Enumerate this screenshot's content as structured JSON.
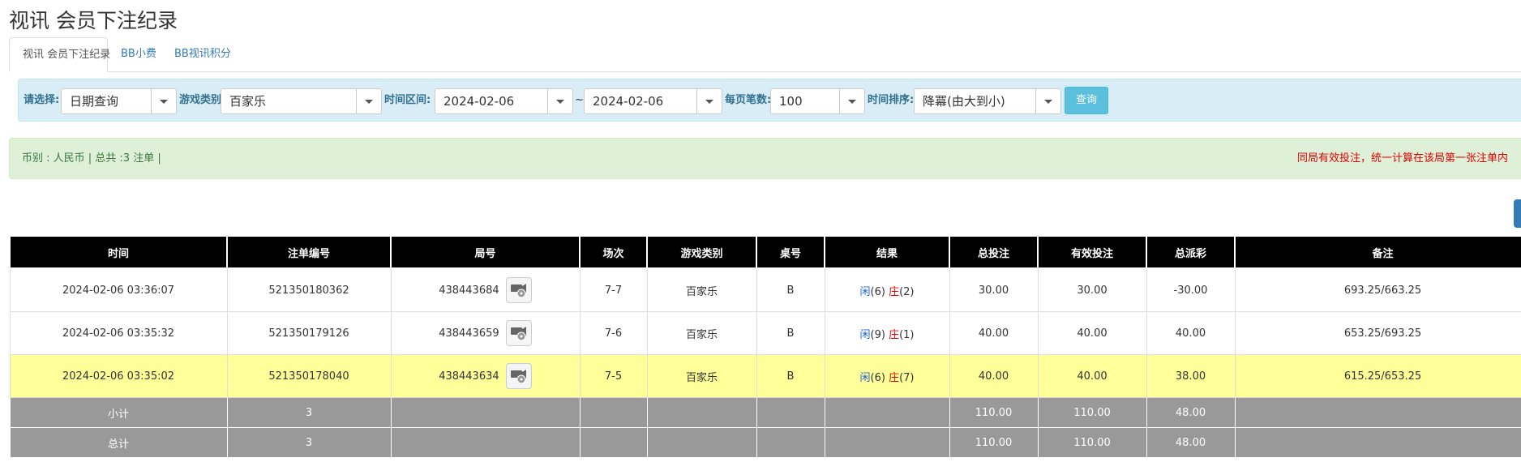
{
  "page": {
    "title": "视讯 会员下注纪录"
  },
  "tabs": [
    {
      "label": "视讯 会员下注纪录",
      "active": true
    },
    {
      "label": "BB小费",
      "active": false
    },
    {
      "label": "BB视讯积分",
      "active": false
    }
  ],
  "filters": {
    "select_label": "请选择:",
    "select_value": "日期查询",
    "game_type_label": "游戏类别",
    "game_type_value": "百家乐",
    "time_range_label": "时间区间:",
    "date_from": "2024-02-06",
    "range_separator": "~",
    "date_to": "2024-02-06",
    "per_page_label": "每页笔数:",
    "per_page_value": "100",
    "sort_label": "时间排序:",
    "sort_value": "降冪(由大到小)",
    "query_button": "查询"
  },
  "summary": {
    "left": "币别 : 人民币 | 总共 :3 注单 |",
    "right_notice": "同局有效投注，统一计算在该局第一张注单内"
  },
  "table": {
    "headers": [
      "时间",
      "注单编号",
      "局号",
      "场次",
      "游戏类别",
      "桌号",
      "结果",
      "总投注",
      "有效投注",
      "总派彩",
      "备注"
    ],
    "rows": [
      {
        "time": "2024-02-06 03:36:07",
        "bet_id": "521350180362",
        "round": "438443684",
        "session": "7-7",
        "game": "百家乐",
        "table": "B",
        "player_label": "闲",
        "player_score": "(6)",
        "banker_label": "庄",
        "banker_score": "(2)",
        "total_bet": "30.00",
        "valid_bet": "30.00",
        "payout": "-30.00",
        "note": "693.25/663.25",
        "highlight": false
      },
      {
        "time": "2024-02-06 03:35:32",
        "bet_id": "521350179126",
        "round": "438443659",
        "session": "7-6",
        "game": "百家乐",
        "table": "B",
        "player_label": "闲",
        "player_score": "(9)",
        "banker_label": "庄",
        "banker_score": "(1)",
        "total_bet": "40.00",
        "valid_bet": "40.00",
        "payout": "40.00",
        "note": "653.25/693.25",
        "highlight": false
      },
      {
        "time": "2024-02-06 03:35:02",
        "bet_id": "521350178040",
        "round": "438443634",
        "session": "7-5",
        "game": "百家乐",
        "table": "B",
        "player_label": "闲",
        "player_score": "(6)",
        "banker_label": "庄",
        "banker_score": "(7)",
        "total_bet": "40.00",
        "valid_bet": "40.00",
        "payout": "38.00",
        "note": "615.25/653.25",
        "highlight": true
      }
    ],
    "subtotal": {
      "label": "小计",
      "count": "3",
      "total_bet": "110.00",
      "valid_bet": "110.00",
      "payout": "48.00"
    },
    "total": {
      "label": "总计",
      "count": "3",
      "total_bet": "110.00",
      "valid_bet": "110.00",
      "payout": "48.00"
    }
  },
  "colors": {
    "blue_link": "#1e63d6",
    "red_negative": "#e00000",
    "highlight_row": "#ffff99",
    "header_bg": "#000000",
    "summary_row_bg": "#999999"
  }
}
